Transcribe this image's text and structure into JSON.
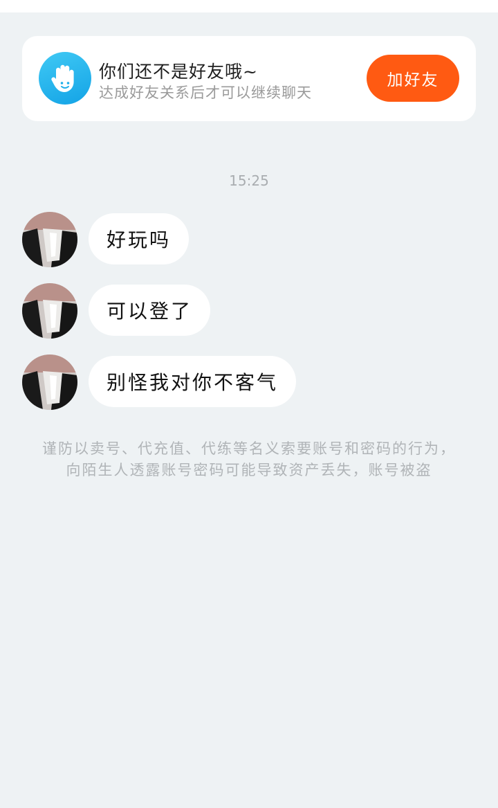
{
  "friend_prompt": {
    "title": "你们还不是好友哦~",
    "subtitle": "达成好友关系后才可以继续聊天",
    "add_button_label": "加好友",
    "icon": "hand-wave-icon",
    "icon_color": "#1eaeea",
    "button_color": "#ff5a12"
  },
  "chat": {
    "timestamp": "15:25",
    "messages": [
      {
        "text": "好玩吗",
        "avatar": "user-avatar"
      },
      {
        "text": "可以登了",
        "avatar": "user-avatar"
      },
      {
        "text": "别怪我对你不客气",
        "avatar": "user-avatar"
      }
    ],
    "security_notice": "谨防以卖号、代充值、代练等名义索要账号和密码的行为，向陌生人透露账号密码可能导致资产丢失，账号被盗"
  }
}
